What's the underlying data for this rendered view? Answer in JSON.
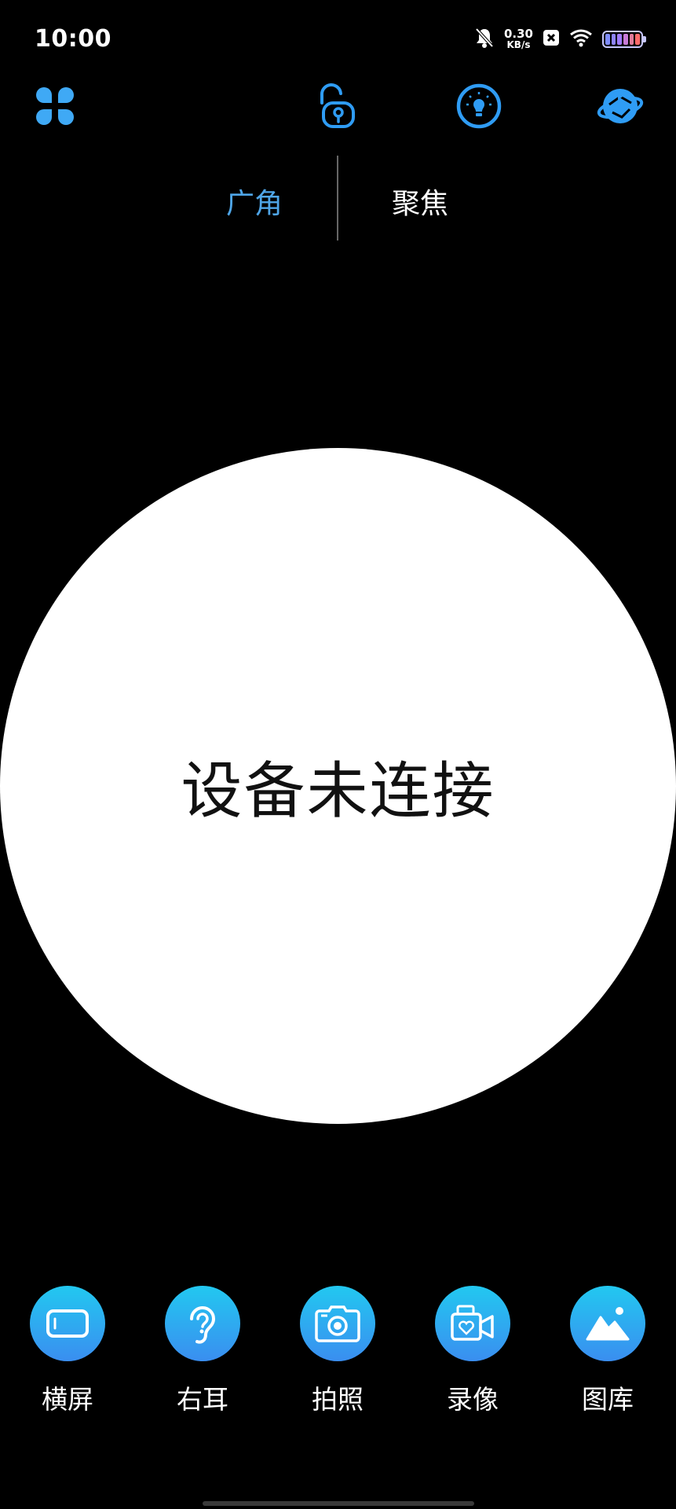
{
  "status_bar": {
    "time": "10:00",
    "net_speed_value": "0.30",
    "net_speed_unit": "KB/s",
    "icons": [
      "bell-muted-icon",
      "close-box-icon",
      "wifi-icon",
      "battery-icon"
    ],
    "battery_colors": [
      "#7f8cff",
      "#8f84ff",
      "#a07cff",
      "#c77bd7",
      "#e07a9a",
      "#ff6a6a"
    ]
  },
  "toolbar": {
    "icons": [
      "apps-icon",
      "unlock-icon",
      "bulb-icon",
      "rotate-icon"
    ],
    "accent_color": "#2f9cf4"
  },
  "mode_switch": {
    "wide_label": "广角",
    "focus_label": "聚焦",
    "active": "广角",
    "active_color": "#4fa6e8"
  },
  "preview": {
    "status_text": "设备未连接"
  },
  "actions": [
    {
      "label": "横屏",
      "icon": "landscape-icon"
    },
    {
      "label": "右耳",
      "icon": "ear-icon"
    },
    {
      "label": "拍照",
      "icon": "camera-icon"
    },
    {
      "label": "录像",
      "icon": "video-icon"
    },
    {
      "label": "图库",
      "icon": "gallery-icon"
    }
  ]
}
